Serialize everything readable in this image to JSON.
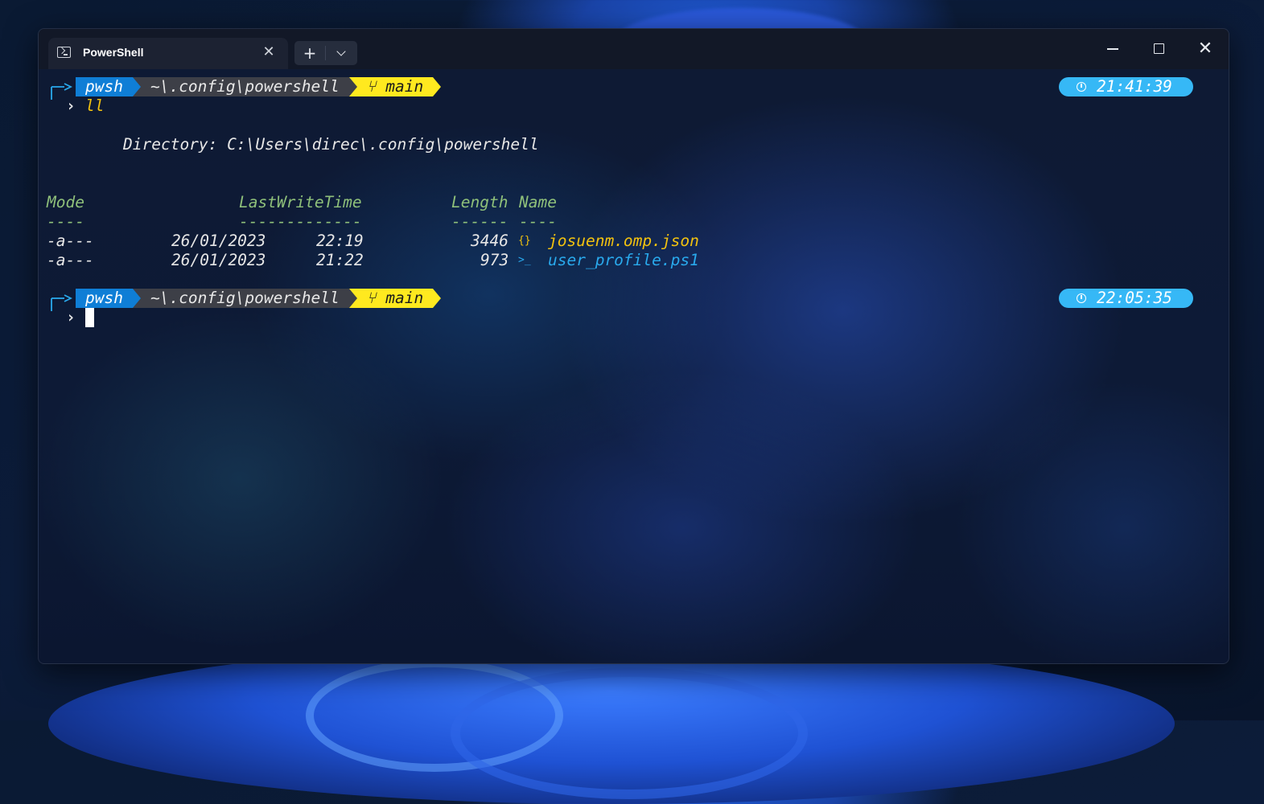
{
  "window": {
    "tab_title": "PowerShell",
    "tab_icon": "powershell-icon",
    "close_glyph": "✕",
    "new_tab_glyph": "+",
    "close_window_glyph": "✕"
  },
  "prompt1": {
    "shell": "pwsh",
    "path": "~\\.config\\powershell",
    "branch": "main",
    "time": "21:41:39",
    "command": "ll"
  },
  "output": {
    "directory_line": "Directory: C:\\Users\\direc\\.config\\powershell",
    "headers": {
      "mode": "Mode",
      "lastwrite": "LastWriteTime",
      "length": "Length",
      "name": "Name"
    },
    "underline": {
      "mode": "----",
      "lastwrite": "-------------",
      "length": "------",
      "name": "----"
    },
    "rows": [
      {
        "mode": "-a---",
        "date": "26/01/2023",
        "time": "22:19",
        "length": "3446",
        "icon": "{}",
        "name": "josuenm.omp.json"
      },
      {
        "mode": "-a---",
        "date": "26/01/2023",
        "time": "21:22",
        "length": "973",
        "icon": ">_",
        "name": "user_profile.ps1"
      }
    ]
  },
  "prompt2": {
    "shell": "pwsh",
    "path": "~\\.config\\powershell",
    "branch": "main",
    "time": "22:05:35"
  },
  "colors": {
    "pwsh_segment": "#0f7ed6",
    "path_segment": "#3d3f47",
    "git_segment": "#ffe91f",
    "time_pill": "#36b8f6",
    "header_green": "#8fc07a",
    "json_yellow": "#f2c20f",
    "ps1_blue": "#29a9ec"
  }
}
